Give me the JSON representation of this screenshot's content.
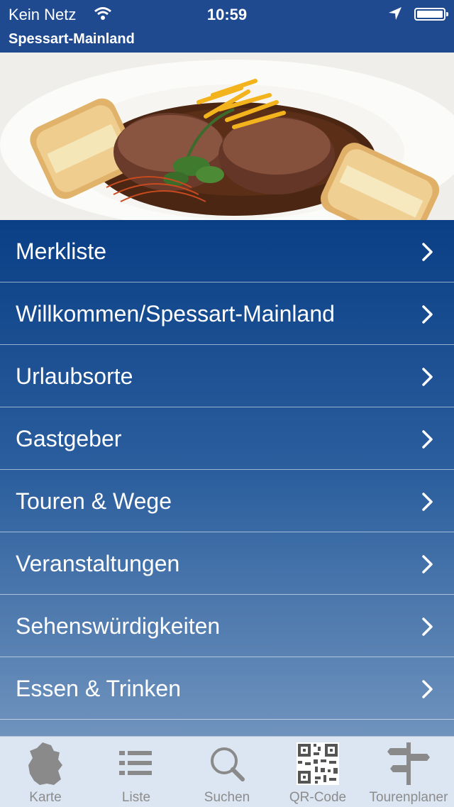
{
  "status_bar": {
    "carrier": "Kein Netz",
    "time": "10:59",
    "icons": [
      "wifi-icon",
      "location-arrow-icon",
      "battery-icon"
    ]
  },
  "header": {
    "title": "Spessart-Mainland"
  },
  "hero": {
    "icon": "food-plate-image"
  },
  "menu": {
    "items": [
      {
        "label": "Merkliste"
      },
      {
        "label": "Willkommen/Spessart-Mainland"
      },
      {
        "label": "Urlaubsorte"
      },
      {
        "label": "Gastgeber"
      },
      {
        "label": "Touren & Wege"
      },
      {
        "label": "Veranstaltungen"
      },
      {
        "label": "Sehenswürdigkeiten"
      },
      {
        "label": "Essen & Trinken"
      }
    ]
  },
  "tabbar": {
    "tabs": [
      {
        "label": "Karte",
        "icon": "germany-map-icon"
      },
      {
        "label": "Liste",
        "icon": "list-icon"
      },
      {
        "label": "Suchen",
        "icon": "search-icon"
      },
      {
        "label": "QR-Code",
        "icon": "qr-code-icon"
      },
      {
        "label": "Tourenplaner",
        "icon": "signpost-icon"
      }
    ]
  },
  "colors": {
    "header_bg": "#1f4a8f",
    "menu_top": "#0a3f86",
    "menu_bottom": "#6f93bd",
    "tabbar_bg": "#dce6f2",
    "tab_label": "#8c8c8c"
  }
}
